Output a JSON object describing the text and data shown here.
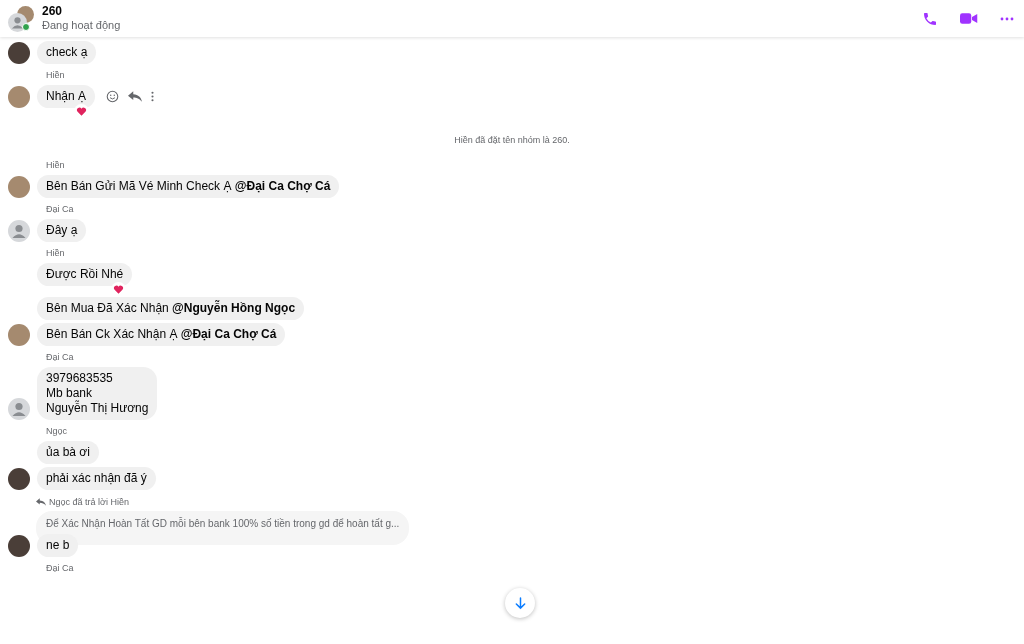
{
  "header": {
    "title": "260",
    "status": "Đang hoạt động",
    "online": true
  },
  "items": [
    {
      "kind": "message",
      "avatar": {
        "kind": "dark"
      },
      "lines": [
        "check ạ"
      ],
      "reacted": false,
      "actions": false
    },
    {
      "kind": "sender",
      "name": "Hiền"
    },
    {
      "kind": "message",
      "avatar": {
        "kind": "photo"
      },
      "lines": [
        "Nhận Ạ"
      ],
      "reacted": true,
      "actions": true
    },
    {
      "kind": "notice",
      "text": "Hiền đã đặt tên nhóm là 260."
    },
    {
      "kind": "sender",
      "name": "Hiền"
    },
    {
      "kind": "message",
      "avatar": {
        "kind": "photo"
      },
      "lines": [
        "Bên Bán Gửi Mã Vé Minh Check Ạ **@Đại Ca Chợ Cá**"
      ],
      "reacted": false,
      "actions": false
    },
    {
      "kind": "sender",
      "name": "Đại Ca"
    },
    {
      "kind": "message",
      "avatar": {
        "kind": "default"
      },
      "lines": [
        "Đây ạ"
      ],
      "reacted": false,
      "actions": false
    },
    {
      "kind": "sender",
      "name": "Hiền"
    },
    {
      "kind": "message",
      "lines": [
        "Được Rồi Nhé"
      ],
      "reacted": true,
      "actions": false
    },
    {
      "kind": "message",
      "lines": [
        "Bên Mua Đã Xác Nhận **@Nguyễn Hồng Ngọc**"
      ],
      "reacted": false,
      "actions": false
    },
    {
      "kind": "message",
      "avatar": {
        "kind": "photo"
      },
      "lines": [
        "Bên Bán Ck Xác Nhận Ạ **@Đại Ca Chợ Cá**"
      ],
      "reacted": false,
      "actions": false
    },
    {
      "kind": "sender",
      "name": "Đại Ca"
    },
    {
      "kind": "message",
      "avatar": {
        "kind": "default"
      },
      "lines": [
        "3979683535",
        "Mb bank",
        "Nguyễn Thị Hương"
      ],
      "reacted": false,
      "actions": false
    },
    {
      "kind": "sender",
      "name": "Ngọc"
    },
    {
      "kind": "message",
      "lines": [
        "ủa bà ơi"
      ],
      "reacted": false,
      "actions": false
    },
    {
      "kind": "message",
      "avatar": {
        "kind": "dark"
      },
      "lines": [
        "phải xác nhận đã ý"
      ],
      "reacted": false,
      "actions": false
    },
    {
      "kind": "reply",
      "label": "Ngọc đã trả lời Hiền",
      "quote": "Để Xác Nhận Hoàn Tất GD mỗi bên bank 100% số tiền trong gd để hoàn tất g..."
    },
    {
      "kind": "message",
      "avatar": {
        "kind": "dark"
      },
      "lines": [
        "ne b"
      ],
      "reacted": false,
      "actions": false
    },
    {
      "kind": "sender",
      "name": "Đại Ca"
    }
  ]
}
